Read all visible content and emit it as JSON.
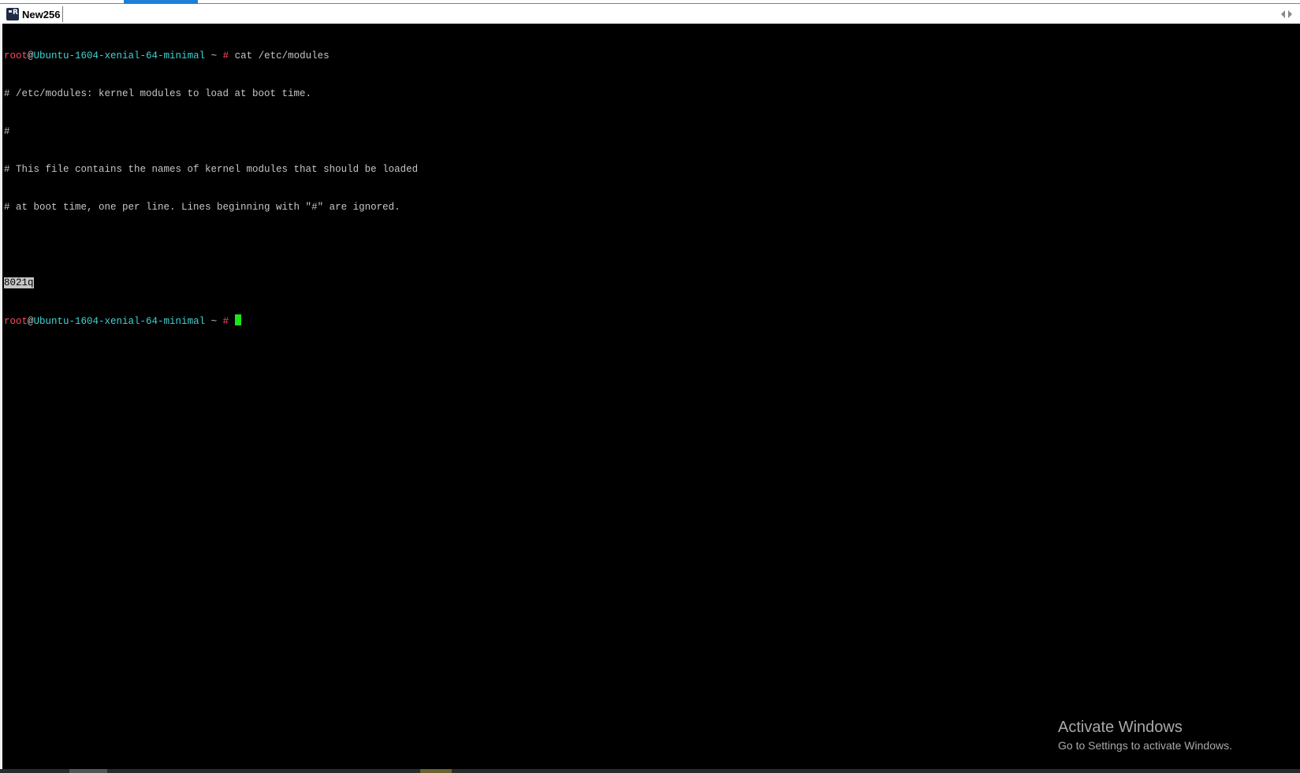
{
  "tab": {
    "icon": "terminal-app-icon",
    "label": "New256"
  },
  "colors": {
    "terminal_bg": "#000000",
    "prompt_user": "#ff4a68",
    "prompt_host": "#3fd3d3",
    "cursor": "#19e619",
    "accent": "#1e7fd8"
  },
  "terminal": {
    "prompt_user": "root",
    "prompt_at": "@",
    "prompt_host": "Ubuntu-1604-xenial-64-minimal",
    "prompt_path": " ~ ",
    "prompt_symbol": "#",
    "command": " cat /etc/modules",
    "output": [
      "# /etc/modules: kernel modules to load at boot time.",
      "#",
      "# This file contains the names of kernel modules that should be loaded",
      "# at boot time, one per line. Lines beginning with \"#\" are ignored.",
      ""
    ],
    "selected_line": "8021q",
    "cursor_after": " "
  },
  "watermark": {
    "title": "Activate Windows",
    "subtitle": "Go to Settings to activate Windows."
  }
}
